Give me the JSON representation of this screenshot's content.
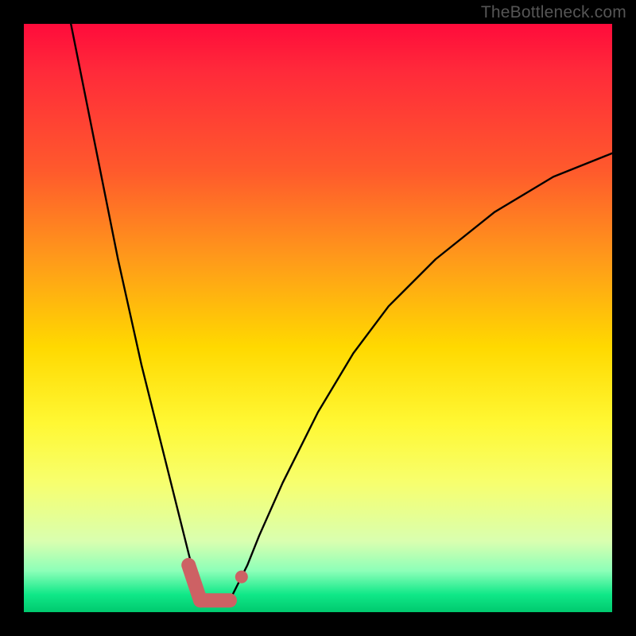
{
  "watermark": "TheBottleneck.com",
  "chart_data": {
    "type": "line",
    "title": "",
    "xlabel": "",
    "ylabel": "",
    "xlim": [
      0,
      100
    ],
    "ylim": [
      0,
      100
    ],
    "series": [
      {
        "name": "bottleneck-curve",
        "x": [
          8,
          10,
          12,
          14,
          16,
          18,
          20,
          22,
          24,
          26,
          28,
          29,
          30,
          31,
          32,
          33,
          34,
          35,
          36,
          38,
          40,
          44,
          50,
          56,
          62,
          70,
          80,
          90,
          100
        ],
        "y": [
          100,
          90,
          80,
          70,
          60,
          51,
          42,
          34,
          26,
          18,
          10,
          6,
          4,
          2,
          1,
          1,
          1,
          2,
          4,
          8,
          13,
          22,
          34,
          44,
          52,
          60,
          68,
          74,
          78
        ]
      }
    ],
    "markers": [
      {
        "name": "left-dot-1",
        "x": 28,
        "y": 8
      },
      {
        "name": "left-dot-2",
        "x": 29,
        "y": 5
      },
      {
        "name": "bottom-bar-start",
        "x": 30,
        "y": 2
      },
      {
        "name": "bottom-bar-end",
        "x": 35,
        "y": 2
      },
      {
        "name": "right-dot",
        "x": 37,
        "y": 6
      }
    ],
    "gradient_stops": [
      {
        "pos": 0,
        "color": "#ff0b3b"
      },
      {
        "pos": 25,
        "color": "#ff5a2c"
      },
      {
        "pos": 55,
        "color": "#ffd900"
      },
      {
        "pos": 78,
        "color": "#f7ff6e"
      },
      {
        "pos": 93,
        "color": "#8cffb8"
      },
      {
        "pos": 100,
        "color": "#00c96e"
      }
    ],
    "marker_color": "#cd6164",
    "curve_color": "#000000"
  }
}
